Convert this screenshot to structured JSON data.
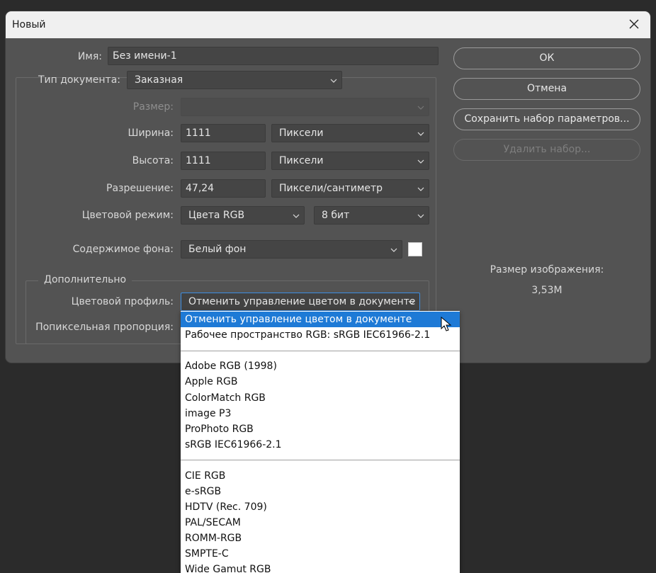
{
  "dialog": {
    "title": "Новый"
  },
  "form": {
    "name_label": "Имя:",
    "name_value": "Без имени-1",
    "doc_type_label": "Тип документа:",
    "doc_type_value": "Заказная",
    "size_label": "Размер:",
    "size_value": "",
    "width_label": "Ширина:",
    "width_value": "1111",
    "width_unit": "Пиксели",
    "height_label": "Высота:",
    "height_value": "1111",
    "height_unit": "Пиксели",
    "resolution_label": "Разрешение:",
    "resolution_value": "47,24",
    "resolution_unit": "Пиксели/сантиметр",
    "color_mode_label": "Цветовой режим:",
    "color_mode_value": "Цвета RGB",
    "bit_depth_value": "8 бит",
    "bg_label": "Содержимое фона:",
    "bg_value": "Белый фон",
    "bg_swatch_color": "#ffffff"
  },
  "advanced": {
    "legend": "Дополнительно",
    "profile_label": "Цветовой профиль:",
    "profile_value": "Отменить управление цветом в документе",
    "pixel_aspect_label": "Попиксельная пропорция:"
  },
  "buttons": {
    "ok": "ОК",
    "cancel": "Отмена",
    "save_preset": "Сохранить набор параметров...",
    "delete_preset": "Удалить набор..."
  },
  "image_size": {
    "label": "Размер изображения:",
    "value": "3,53M"
  },
  "dropdown": {
    "selected_index": 0,
    "items": [
      "Отменить управление цветом в документе",
      "Рабочее пространство RGB:  sRGB IEC61966-2.1",
      "Adobe RGB (1998)",
      "Apple RGB",
      "ColorMatch RGB",
      "image P3",
      "ProPhoto RGB",
      "sRGB IEC61966-2.1",
      "CIE RGB",
      "e-sRGB",
      "HDTV (Rec. 709)",
      "PAL/SECAM",
      "ROMM-RGB",
      "SMPTE-C",
      "Wide Gamut RGB"
    ]
  },
  "colors": {
    "dialog_bg": "#535353",
    "accent_selected": "#1e7ad6",
    "focus_border": "#3d8ee3"
  }
}
